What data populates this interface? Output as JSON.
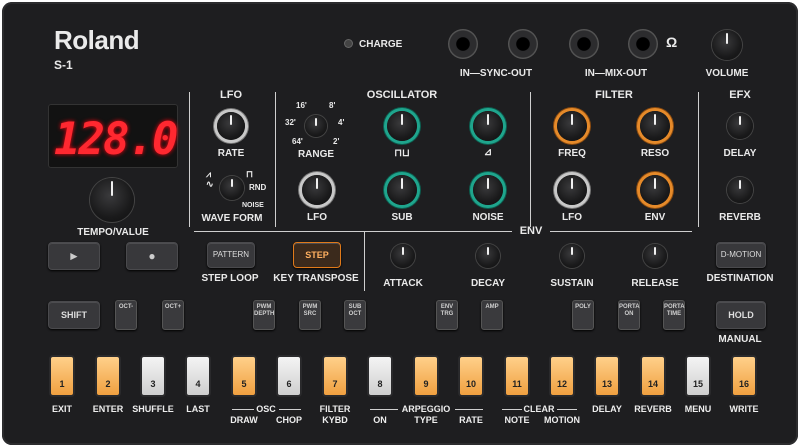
{
  "brand": {
    "logo": "Roland",
    "model": "S-1"
  },
  "display": {
    "value": "128.0"
  },
  "top": {
    "charge_label": "CHARGE",
    "sync_label": "IN—SYNC-OUT",
    "mix_label": "IN—MIX-OUT",
    "volume_label": "VOLUME"
  },
  "left": {
    "tempo_label": "TEMPO/VALUE",
    "play_icon": "play-icon",
    "record_icon": "record-icon"
  },
  "lfo": {
    "title": "LFO",
    "rate_label": "RATE",
    "wave_form_label": "WAVE FORM",
    "rnd_label": "RND",
    "noise_label": "NOISE"
  },
  "oscillator": {
    "title": "OSCILLATOR",
    "range_label": "RANGE",
    "range_ticks": [
      "16'",
      "8'",
      "32'",
      "4'",
      "64'",
      "2'"
    ],
    "pulse_label": "⊓⊔",
    "saw_label": "⊿",
    "lfo_label": "LFO",
    "sub_label": "SUB",
    "noise_label": "NOISE"
  },
  "filter": {
    "title": "FILTER",
    "freq_label": "FREQ",
    "reso_label": "RESO",
    "lfo_label": "LFO",
    "env_label": "ENV"
  },
  "efx": {
    "title": "EFX",
    "delay_label": "DELAY",
    "reverb_label": "REVERB"
  },
  "env": {
    "title": "ENV",
    "attack_label": "ATTACK",
    "decay_label": "DECAY",
    "sustain_label": "SUSTAIN",
    "release_label": "RELEASE"
  },
  "mode_buttons": {
    "pattern": "PATTERN",
    "step": "STEP",
    "step_loop": "STEP LOOP",
    "key_transpose": "KEY TRANSPOSE",
    "dmotion": "D-MOTION",
    "destination": "DESTINATION",
    "hold": "HOLD",
    "manual": "MANUAL",
    "shift": "SHIFT"
  },
  "small_buttons": [
    {
      "label": "OCT-"
    },
    {
      "label": "OCT+"
    },
    {
      "label": "PWM DEPTH"
    },
    {
      "label": "PWM SRC"
    },
    {
      "label": "SUB OCT"
    },
    {
      "label": "ENV TRG"
    },
    {
      "label": "AMP"
    },
    {
      "label": "POLY"
    },
    {
      "label": "PORTA ON"
    },
    {
      "label": "PORTA TIME"
    }
  ],
  "pads": [
    {
      "num": "1",
      "label": "EXIT",
      "color": "orange"
    },
    {
      "num": "2",
      "label": "ENTER",
      "color": "orange"
    },
    {
      "num": "3",
      "label": "SHUFFLE",
      "color": "white"
    },
    {
      "num": "4",
      "label": "LAST",
      "color": "white"
    },
    {
      "num": "5",
      "label": "DRAW",
      "color": "orange"
    },
    {
      "num": "6",
      "label": "CHOP",
      "color": "white"
    },
    {
      "num": "7",
      "label": "KYBD",
      "color": "orange"
    },
    {
      "num": "8",
      "label": "ON",
      "color": "white"
    },
    {
      "num": "9",
      "label": "TYPE",
      "color": "orange"
    },
    {
      "num": "10",
      "label": "RATE",
      "color": "orange"
    },
    {
      "num": "11",
      "label": "NOTE",
      "color": "orange"
    },
    {
      "num": "12",
      "label": "MOTION",
      "color": "orange"
    },
    {
      "num": "13",
      "label": "DELAY",
      "color": "orange"
    },
    {
      "num": "14",
      "label": "REVERB",
      "color": "orange"
    },
    {
      "num": "15",
      "label": "MENU",
      "color": "white"
    },
    {
      "num": "16",
      "label": "WRITE",
      "color": "orange"
    }
  ],
  "pad_groups": {
    "osc": "OSC",
    "filter": "FILTER",
    "arpeggio": "ARPEGGIO",
    "clear": "CLEAR"
  },
  "colors": {
    "panel": "#1e1e20",
    "orange_pad": "#f0a040",
    "green_ring": "#1fa58d",
    "orange_ring": "#e58a2a",
    "display": "#ff2830"
  }
}
